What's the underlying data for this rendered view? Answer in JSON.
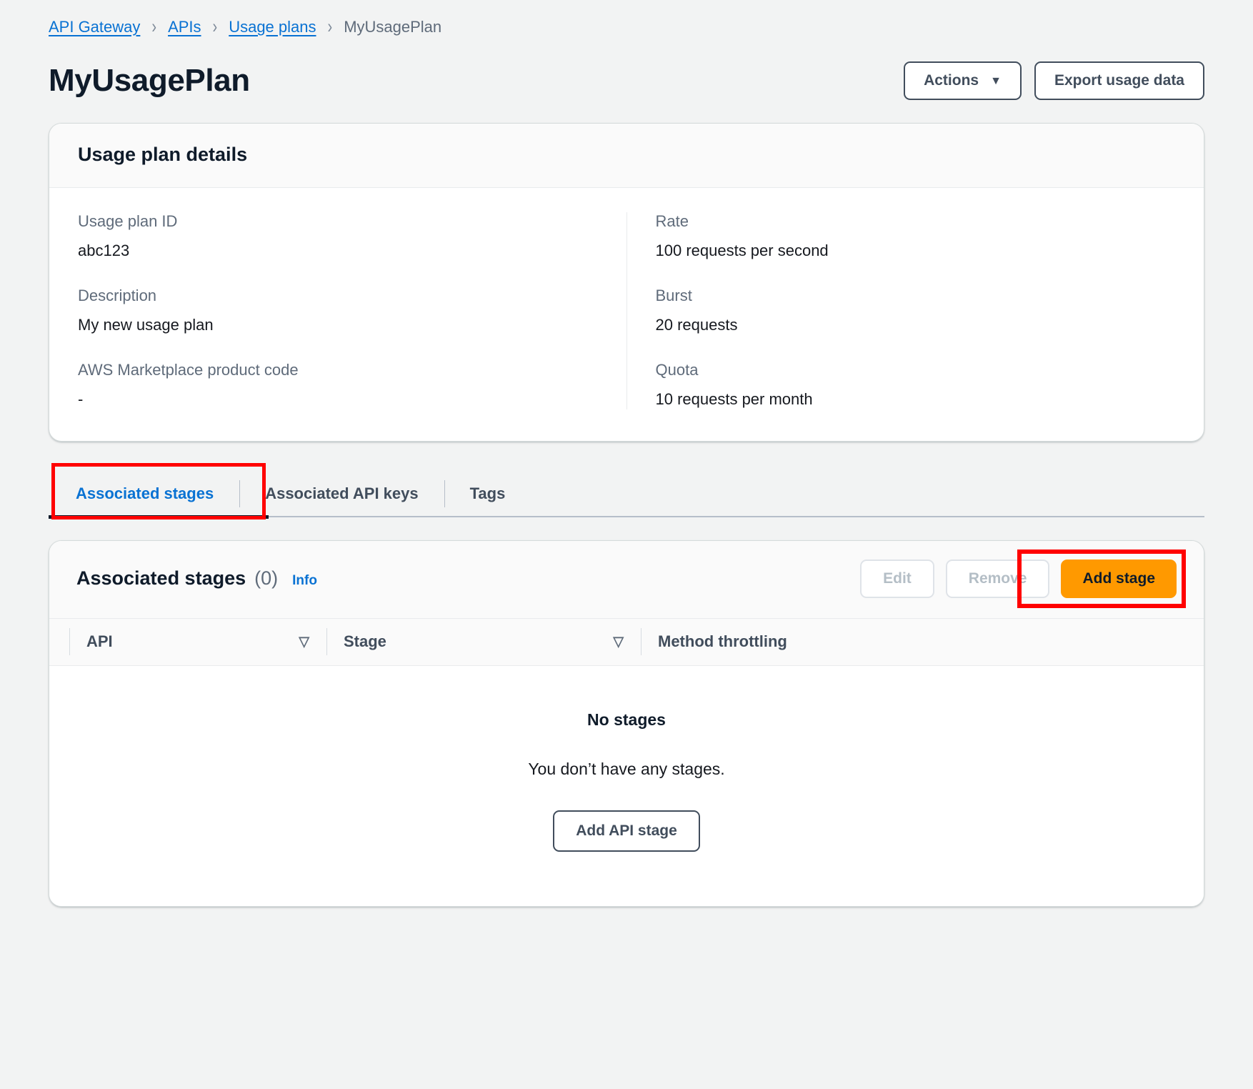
{
  "breadcrumb": {
    "items": [
      {
        "label": "API Gateway",
        "current": false
      },
      {
        "label": "APIs",
        "current": false
      },
      {
        "label": "Usage plans",
        "current": false
      },
      {
        "label": "MyUsagePlan",
        "current": true
      }
    ],
    "separator": "›"
  },
  "header": {
    "title": "MyUsagePlan",
    "actions_label": "Actions",
    "actions_caret": "▼",
    "export_label": "Export usage data"
  },
  "details": {
    "heading": "Usage plan details",
    "left_fields": [
      {
        "label": "Usage plan ID",
        "value": "abc123"
      },
      {
        "label": "Description",
        "value": "My new usage plan"
      },
      {
        "label": "AWS Marketplace product code",
        "value": "-"
      }
    ],
    "right_fields": [
      {
        "label": "Rate",
        "value": "100 requests per second"
      },
      {
        "label": "Burst",
        "value": "20 requests"
      },
      {
        "label": "Quota",
        "value": "10 requests per month"
      }
    ]
  },
  "tabs": [
    {
      "label": "Associated stages",
      "active": true
    },
    {
      "label": "Associated API keys",
      "active": false
    },
    {
      "label": "Tags",
      "active": false
    }
  ],
  "stages_section": {
    "title": "Associated stages",
    "count": "(0)",
    "info_label": "Info",
    "edit_label": "Edit",
    "remove_label": "Remove",
    "add_stage_label": "Add stage",
    "columns": [
      {
        "label": "API",
        "sortable": true,
        "sort_icon": "▽"
      },
      {
        "label": "Stage",
        "sortable": true,
        "sort_icon": "▽"
      },
      {
        "label": "Method throttling",
        "sortable": false,
        "sort_icon": ""
      }
    ],
    "empty_title": "No stages",
    "empty_subtitle": "You don’t have any stages.",
    "empty_button_label": "Add API stage"
  },
  "colors": {
    "accent_link": "#0972d3",
    "primary_button": "#ff9900",
    "annotation": "#ff0000",
    "page_background": "#f2f3f3"
  }
}
